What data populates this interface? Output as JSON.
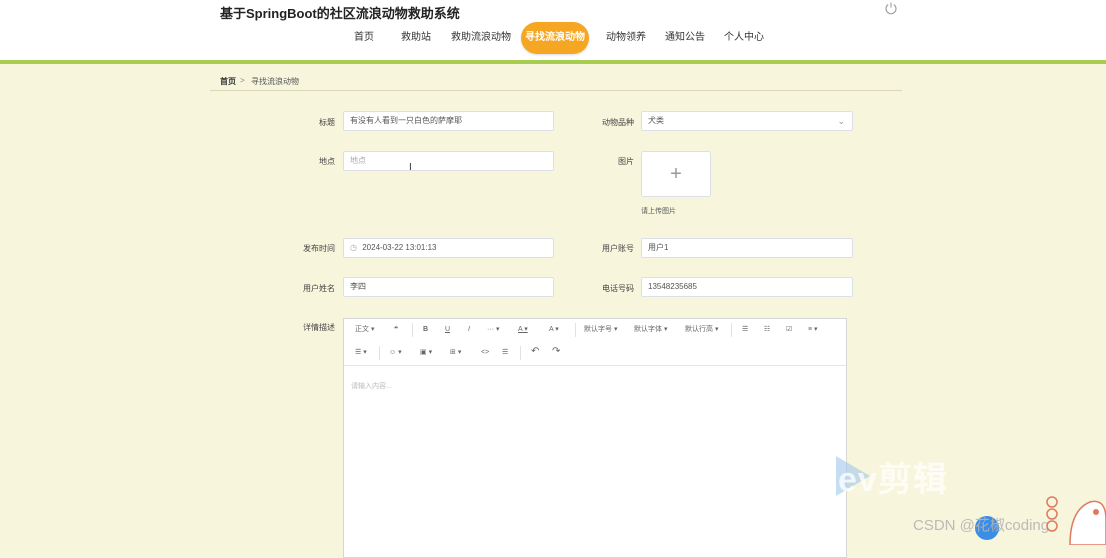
{
  "header": {
    "site_title": "基于SpringBoot的社区流浪动物救助系统",
    "power_icon": "power-icon"
  },
  "nav": {
    "items": [
      "首页",
      "救助站",
      "救助流浪动物",
      "寻找流浪动物",
      "动物领养",
      "通知公告",
      "个人中心"
    ],
    "active_index": 3,
    "active_color": "#f5a623"
  },
  "breadcrumb": {
    "home": "首页",
    "separator": ">",
    "current": "寻找流浪动物"
  },
  "form": {
    "title_label": "标题",
    "title_value": "有没有人看到一只白色的萨摩耶",
    "breed_label": "动物品种",
    "breed_value": "犬类",
    "location_label": "地点",
    "location_placeholder": "地点",
    "image_label": "图片",
    "upload_hint": "请上传图片",
    "publish_time_label": "发布时间",
    "publish_time_value": "2024-03-22 13:01:13",
    "account_label": "用户账号",
    "account_value": "用户1",
    "name_label": "用户姓名",
    "name_value": "李四",
    "phone_label": "电话号码",
    "phone_value": "13548235685",
    "detail_label": "详情描述"
  },
  "editor": {
    "toolbar_row1": [
      "正文",
      "❝",
      "B",
      "U",
      "I",
      "···",
      "A",
      "A",
      "默认字号",
      "默认字体",
      "默认行高",
      "☰",
      "☷",
      "☑",
      "≡"
    ],
    "toolbar_row2": [
      "☰",
      "☺",
      "▣",
      "⊞",
      "<>",
      "☰",
      "↶",
      "↷"
    ],
    "placeholder": "请输入内容..."
  },
  "watermark": {
    "ev_text": "ev剪辑",
    "csdn_text": "CSDN @花椒coding"
  }
}
